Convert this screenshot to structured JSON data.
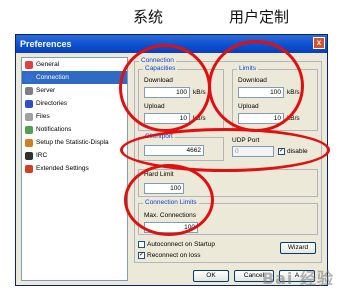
{
  "annotations": {
    "left": "系统",
    "right": "用户定制"
  },
  "window": {
    "title": "Preferences",
    "close_glyph": "x"
  },
  "sidebar": {
    "items": [
      {
        "label": "General",
        "icon": "general-icon",
        "color": "#e04040"
      },
      {
        "label": "Connection",
        "icon": "connection-icon",
        "color": "#3070d0",
        "selected": true
      },
      {
        "label": "Server",
        "icon": "server-icon",
        "color": "#808080"
      },
      {
        "label": "Directories",
        "icon": "folder-icon",
        "color": "#3050c0"
      },
      {
        "label": "Files",
        "icon": "files-icon",
        "color": "#a0a0a0"
      },
      {
        "label": "Notifications",
        "icon": "notifications-icon",
        "color": "#50a050"
      },
      {
        "label": "Setup the Statistic-Displa",
        "icon": "statistics-icon",
        "color": "#d08020"
      },
      {
        "label": "IRC",
        "icon": "irc-icon",
        "color": "#303030"
      },
      {
        "label": "Extended Settings",
        "icon": "extended-icon",
        "color": "#d04020"
      }
    ]
  },
  "connection": {
    "group_title": "Connection",
    "capacities": {
      "title": "Capacities",
      "download_label": "Download",
      "download_value": "100",
      "download_unit": "kB/s",
      "upload_label": "Upload",
      "upload_value": "10",
      "upload_unit": "kB/s"
    },
    "limits": {
      "title": "Limits",
      "download_label": "Download",
      "download_value": "100",
      "download_unit": "kB/s",
      "upload_label": "Upload",
      "upload_value": "10",
      "upload_unit": "kB/s"
    },
    "clientport": {
      "title": "Clientport",
      "value": "4662"
    },
    "udp": {
      "title": "UDP Port",
      "value": "0",
      "disable_label": "disable",
      "disable_checked": true
    },
    "hard_limit": {
      "title": "Hard Limit",
      "value": "100"
    },
    "connection_limits": {
      "title": "Connection Limits",
      "max_label": "Max. Connections",
      "value": "100"
    },
    "autoconnect_label": "Autoconnect on Startup",
    "reconnect_label": "Reconnect on loss",
    "wizard_label": "Wizard"
  },
  "buttons": {
    "ok": "OK",
    "cancel": "Cancel",
    "apply": "A"
  },
  "watermark": "Bai 经验"
}
